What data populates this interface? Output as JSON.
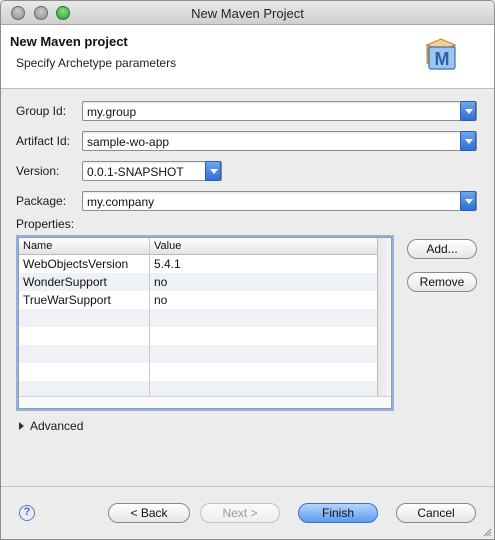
{
  "window": {
    "title": "New Maven Project"
  },
  "banner": {
    "title": "New Maven project",
    "subtitle": "Specify Archetype parameters",
    "logo_letter": "M"
  },
  "form": {
    "group_id": {
      "label": "Group Id:",
      "value": "my.group"
    },
    "artifact_id": {
      "label": "Artifact Id:",
      "value": "sample-wo-app"
    },
    "version": {
      "label": "Version:",
      "value": "0.0.1-SNAPSHOT"
    },
    "package": {
      "label": "Package:",
      "value": "my.company"
    }
  },
  "properties": {
    "label": "Properties:",
    "columns": [
      "Name",
      "Value"
    ],
    "rows": [
      [
        "WebObjectsVersion",
        "5.4.1"
      ],
      [
        "WonderSupport",
        "no"
      ],
      [
        "TrueWarSupport",
        "no"
      ]
    ],
    "add_label": "Add...",
    "remove_label": "Remove"
  },
  "advanced_label": "Advanced",
  "footer": {
    "help_icon_glyph": "?",
    "back_label": "< Back",
    "next_label": "Next >",
    "finish_label": "Finish",
    "cancel_label": "Cancel"
  },
  "colors": {
    "accent": "#2c6fd6",
    "focus_ring": "#8db3e6"
  }
}
